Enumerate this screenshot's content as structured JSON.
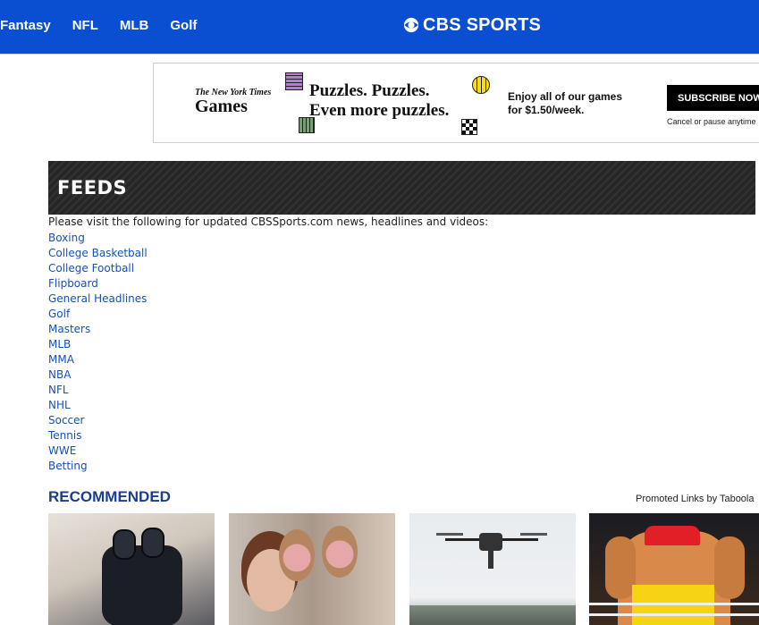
{
  "header": {
    "nav": [
      "Fantasy",
      "NFL",
      "MLB",
      "Golf"
    ],
    "logo_text": "CBS SPORTS",
    "brand_color": "#0a4fd2"
  },
  "ad": {
    "brand_top": "The New York Times",
    "brand_bottom": "Games",
    "headline_line1": "Puzzles. Puzzles.",
    "headline_line2": "Even more puzzles.",
    "copy_line1": "Enjoy all of our games",
    "copy_line2": "for $1.50/week.",
    "cta": "SUBSCRIBE NOW",
    "fine_print": "Cancel or pause anytime"
  },
  "feeds": {
    "title": "FEEDS",
    "intro": "Please visit the following for updated CBSSports.com news, headlines and videos:",
    "links": [
      "Boxing",
      "College Basketball",
      "College Football",
      "Flipboard",
      "General Headlines",
      "Golf",
      "Masters",
      "MLB",
      "MMA",
      "NBA",
      "NFL",
      "NHL",
      "Soccer",
      "Tennis",
      "WWE",
      "Betting"
    ]
  },
  "recommended": {
    "title": "RECOMMENDED",
    "promo": "Promoted Links by Taboola",
    "title_color": "#1a3d8f"
  }
}
